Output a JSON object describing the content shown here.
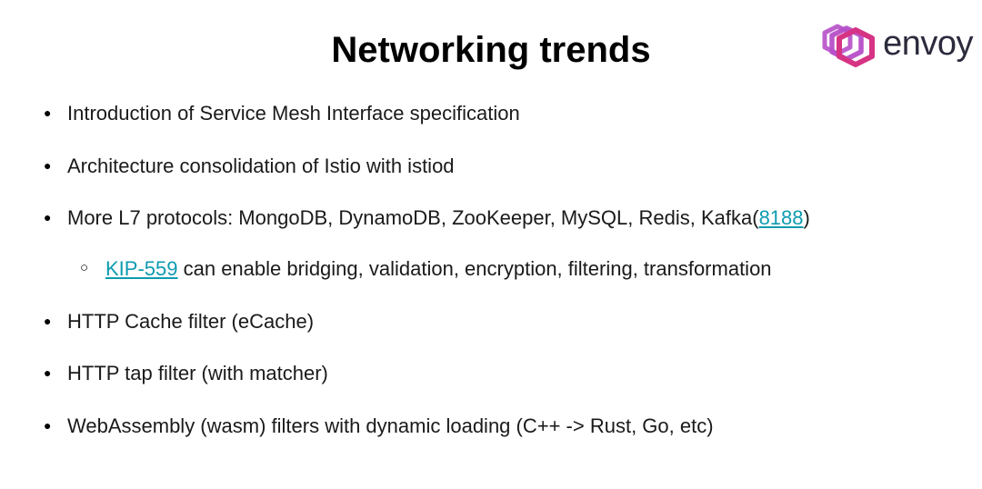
{
  "brand": {
    "name": "envoy",
    "icon": "envoy-logo-icon",
    "colors": {
      "pink": "#d63384",
      "purple": "#7a3fbf",
      "text": "#2b2b3d"
    }
  },
  "title": "Networking trends",
  "bullets": [
    {
      "text": "Introduction of Service Mesh Interface specification"
    },
    {
      "text": "Architecture consolidation of Istio with istiod"
    },
    {
      "prefix": "More L7 protocols: MongoDB, DynamoDB, ZooKeeper, MySQL, Redis, Kafka(",
      "link": "8188",
      "suffix": ")",
      "sub": {
        "link": "KIP-559",
        "suffix": " can enable bridging, validation, encryption, filtering, transformation"
      }
    },
    {
      "text": " HTTP Cache filter (eCache)"
    },
    {
      "text": "HTTP tap filter (with matcher)"
    },
    {
      "text": "WebAssembly (wasm) filters with dynamic loading (C++ -> Rust, Go, etc)"
    }
  ]
}
